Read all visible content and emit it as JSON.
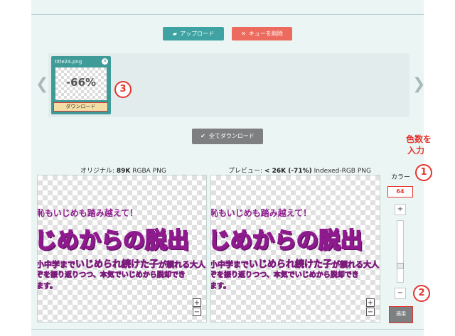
{
  "toolbar": {
    "upload_label": "アップロード",
    "clear_label": "キューを削除"
  },
  "queue": {
    "prev_arrow": "❮",
    "next_arrow": "❯",
    "items": [
      {
        "filename": "title24.png",
        "close": "✕",
        "percent": "-66%",
        "download_label": "ダウンロード"
      }
    ]
  },
  "download_all_label": "全てダウンロード",
  "annotations": {
    "step1": "1",
    "step2": "2",
    "step3": "3",
    "note_line1": "色数を",
    "note_line2": "入力"
  },
  "compare": {
    "original_label": "オリジナル: ",
    "original_size": "89K",
    "original_format": " RGBA PNG",
    "preview_label": "プレビュー: ",
    "preview_size": "< 26K (-71%)",
    "preview_format": " Indexed-RGB PNG"
  },
  "image_text": {
    "line1": "恥もいじめも踏み越えて！",
    "line2": "じめからの脱出",
    "line3_pre": "小中学まで",
    "line3_hl": "いじめられ続けた子",
    "line3_post": "が頼れる大人",
    "line4": "ぞを振り返りつつ、本気でいじめから脱却でき",
    "line5": "ます。"
  },
  "zoom": {
    "in": "+",
    "out": "−"
  },
  "controls": {
    "color_label": "カラー",
    "color_value": "64",
    "plus": "+",
    "minus": "−",
    "slider_value": 0.75,
    "apply_label": "適用"
  },
  "colors": {
    "accent_teal": "#3fa3a3",
    "clear_red": "#ec6b5e",
    "annotation_red": "#e2352f",
    "text_purple": "#8e1a8e"
  }
}
